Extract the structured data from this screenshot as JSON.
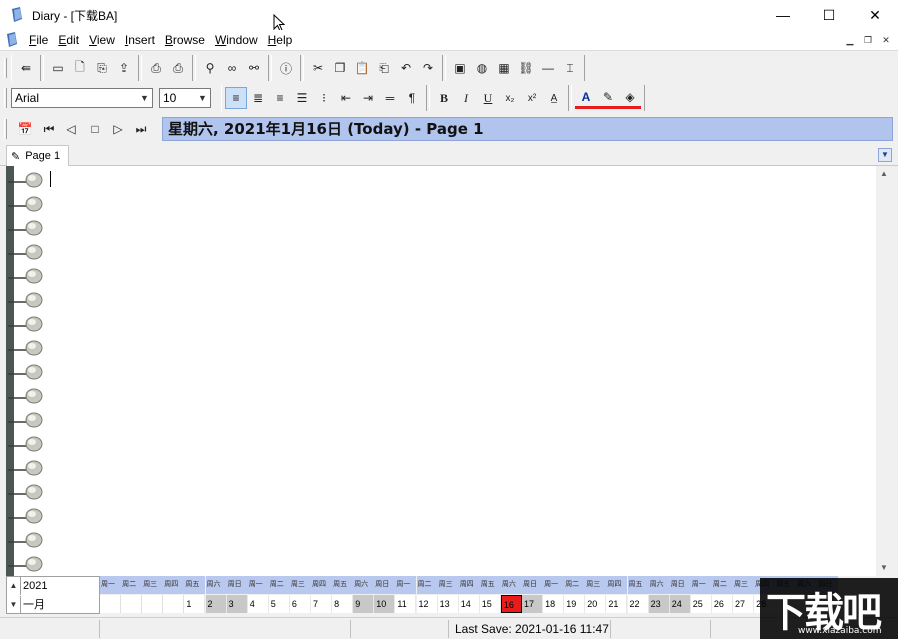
{
  "window": {
    "title": "Diary - [下载BA]",
    "controls": {
      "minimize": "—",
      "maximize": "☐",
      "close": "✕"
    }
  },
  "menu": {
    "items": [
      {
        "accel": "F",
        "rest": "ile"
      },
      {
        "accel": "E",
        "rest": "dit"
      },
      {
        "accel": "V",
        "rest": "iew"
      },
      {
        "accel": "I",
        "rest": "nsert"
      },
      {
        "accel": "B",
        "rest": "rowse"
      },
      {
        "accel": "W",
        "rest": "indow"
      },
      {
        "accel": "H",
        "rest": "elp"
      }
    ]
  },
  "format_toolbar": {
    "font": "Arial",
    "size": "10"
  },
  "nav": {
    "date_banner": "星期六, 2021年1月16日 (Today) - Page 1"
  },
  "tab": {
    "label": "Page 1"
  },
  "calendar": {
    "year": "2021",
    "month": "一月",
    "weekdays": [
      "周一",
      "周二",
      "周三",
      "周四",
      "周五",
      "周六",
      "周日",
      "周一",
      "周二",
      "周三",
      "周四",
      "周五",
      "周六",
      "周日",
      "周一",
      "周二",
      "周三",
      "周四",
      "周五",
      "周六",
      "周日",
      "周一",
      "周二",
      "周三",
      "周四",
      "周五",
      "周六",
      "周日",
      "周一",
      "周二",
      "周三",
      "周四",
      "周五",
      "周六",
      "周日"
    ],
    "days": [
      "",
      "",
      "",
      "",
      "1",
      "2",
      "3",
      "4",
      "5",
      "6",
      "7",
      "8",
      "9",
      "10",
      "11",
      "12",
      "13",
      "14",
      "15",
      "16",
      "17",
      "18",
      "19",
      "20",
      "21",
      "22",
      "23",
      "24",
      "25",
      "26",
      "27",
      "28",
      "",
      "",
      ""
    ],
    "today": "16",
    "weekend_days": [
      "2",
      "3",
      "9",
      "10",
      "16",
      "17",
      "23",
      "24"
    ]
  },
  "status": {
    "last_save": "Last Save: 2021-01-16 11:47"
  },
  "watermark": {
    "brand": "下载吧",
    "url": "www.xiazaiba.com"
  },
  "colors": {
    "date_banner_bg": "#b0c4ee",
    "today_cell": "#e81c1c",
    "calendar_header": "#b8c8ee",
    "spine": "#4b5753"
  }
}
